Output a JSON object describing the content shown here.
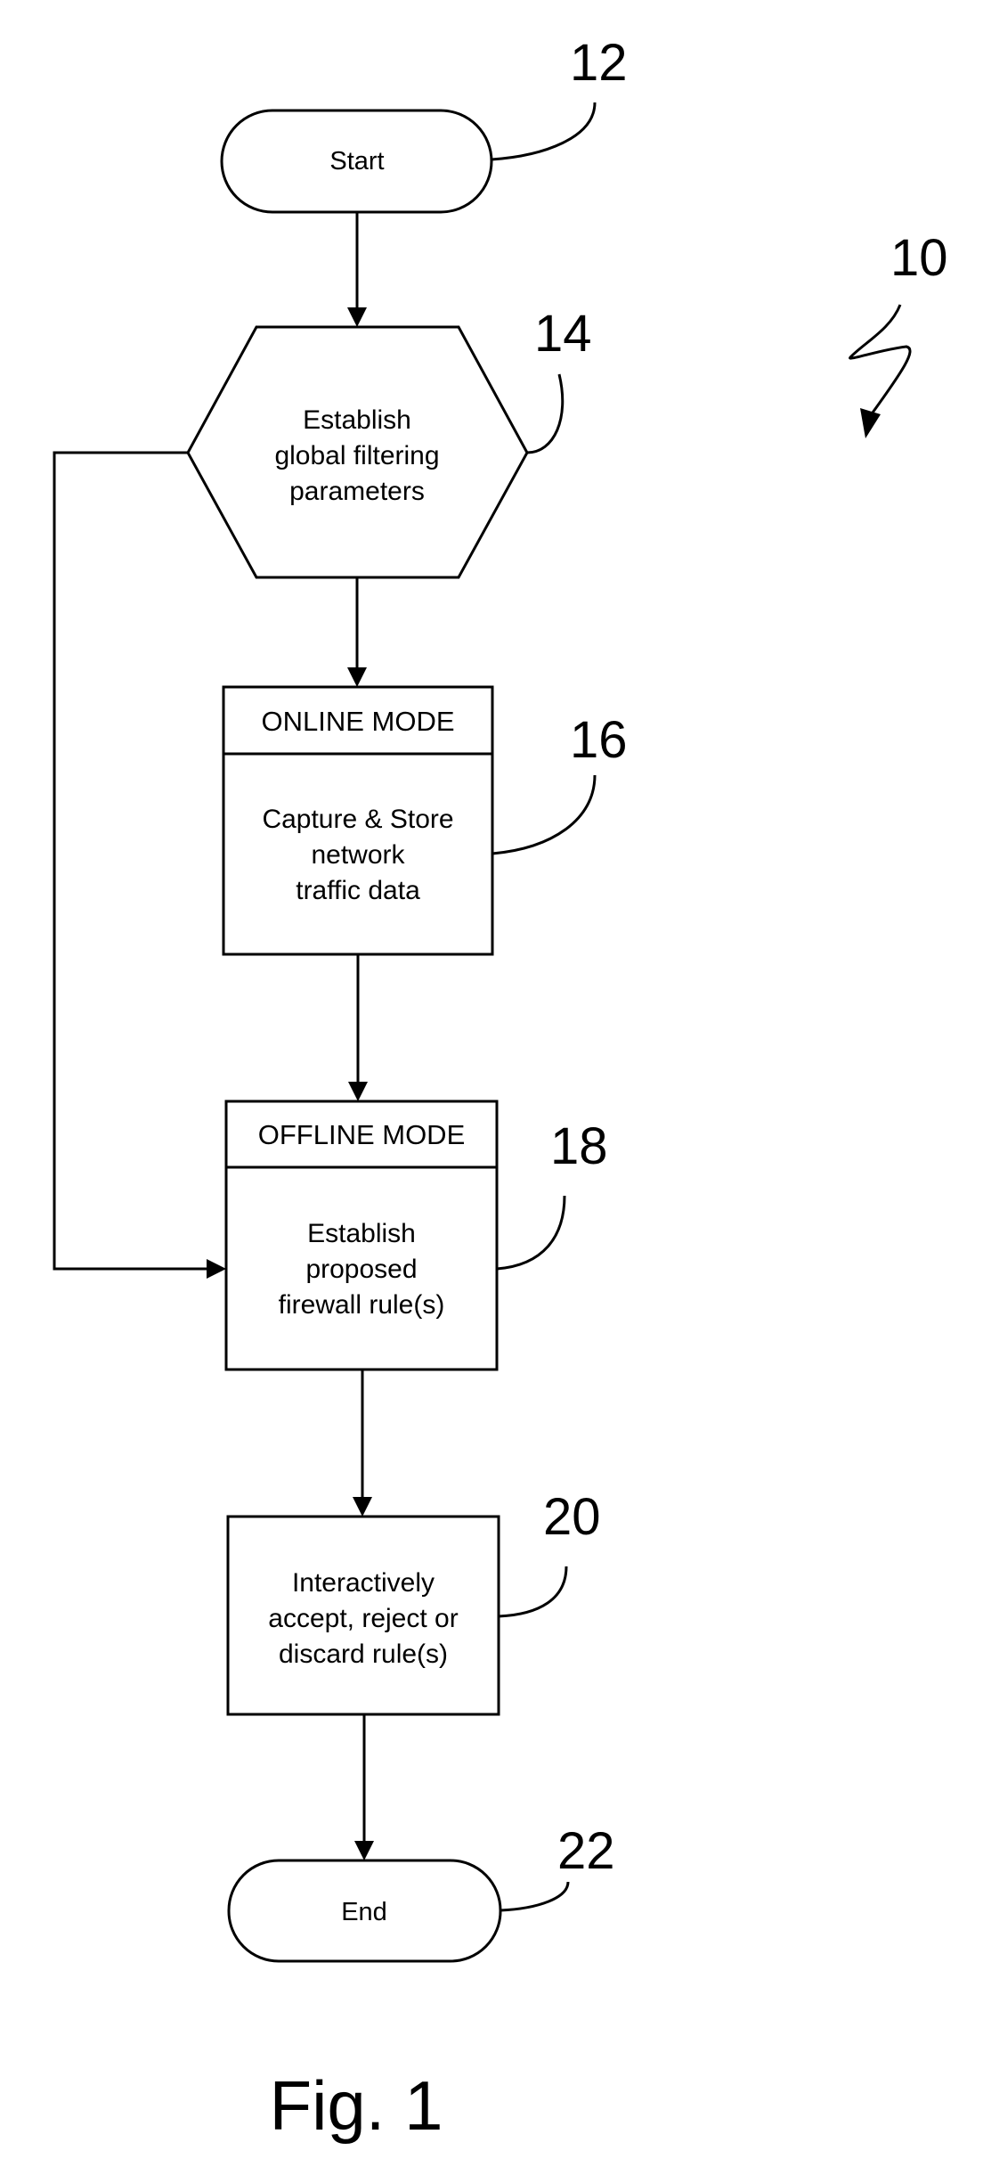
{
  "figure": {
    "caption": "Fig. 1",
    "reference_numeral": "10"
  },
  "nodes": {
    "start": {
      "ref": "12",
      "label": "Start",
      "shape": "terminator"
    },
    "establish_params": {
      "ref": "14",
      "shape": "hexagon",
      "lines": [
        "Establish",
        "global filtering",
        "parameters"
      ]
    },
    "online_mode": {
      "ref": "16",
      "shape": "process-with-header",
      "header": "ONLINE MODE",
      "lines": [
        "Capture & Store",
        "network",
        "traffic data"
      ]
    },
    "offline_mode": {
      "ref": "18",
      "shape": "process-with-header",
      "header": "OFFLINE MODE",
      "lines": [
        "Establish",
        "proposed",
        "firewall rule(s)"
      ]
    },
    "interactive_review": {
      "ref": "20",
      "shape": "process",
      "lines": [
        "Interactively",
        "accept, reject or",
        "discard rule(s)"
      ]
    },
    "end": {
      "ref": "22",
      "label": "End",
      "shape": "terminator"
    }
  },
  "edges": [
    {
      "from": "start",
      "to": "establish_params"
    },
    {
      "from": "establish_params",
      "to": "online_mode"
    },
    {
      "from": "establish_params",
      "to": "offline_mode",
      "route": "left-bypass"
    },
    {
      "from": "online_mode",
      "to": "offline_mode"
    },
    {
      "from": "offline_mode",
      "to": "interactive_review"
    },
    {
      "from": "interactive_review",
      "to": "end"
    }
  ]
}
